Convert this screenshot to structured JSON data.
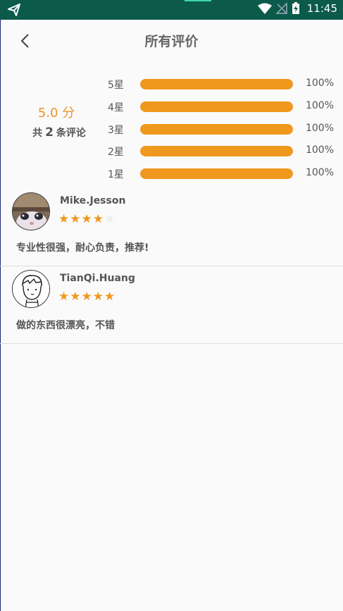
{
  "status_bar": {
    "time": "11:45",
    "icons": [
      "send-icon",
      "wifi-icon",
      "no-signal-icon",
      "battery-charging-icon"
    ]
  },
  "header": {
    "back_icon": "chevron-left-icon",
    "title": "所有评价"
  },
  "summary": {
    "score": "5.0 分",
    "count_prefix": "共",
    "count": "2",
    "count_suffix": "条评论",
    "distribution": [
      {
        "label": "5星",
        "percent_text": "100%",
        "fill": 1.0
      },
      {
        "label": "4星",
        "percent_text": "100%",
        "fill": 1.0
      },
      {
        "label": "3星",
        "percent_text": "100%",
        "fill": 1.0
      },
      {
        "label": "2星",
        "percent_text": "100%",
        "fill": 1.0
      },
      {
        "label": "1星",
        "percent_text": "100%",
        "fill": 1.0
      }
    ]
  },
  "reviews": [
    {
      "name": "Mike.Jesson",
      "stars": 4,
      "max_stars": 5,
      "text": "专业性很强，耐心负责，推荐!",
      "avatar": "cat-photo-avatar"
    },
    {
      "name": "TianQi.Huang",
      "stars": 5,
      "max_stars": 5,
      "text": "做的东西很漂亮，不错",
      "avatar": "line-drawing-boy-avatar"
    }
  ],
  "colors": {
    "status_bar": "#0b5a4a",
    "accent": "#ef981d",
    "score_text": "#f0922a"
  }
}
